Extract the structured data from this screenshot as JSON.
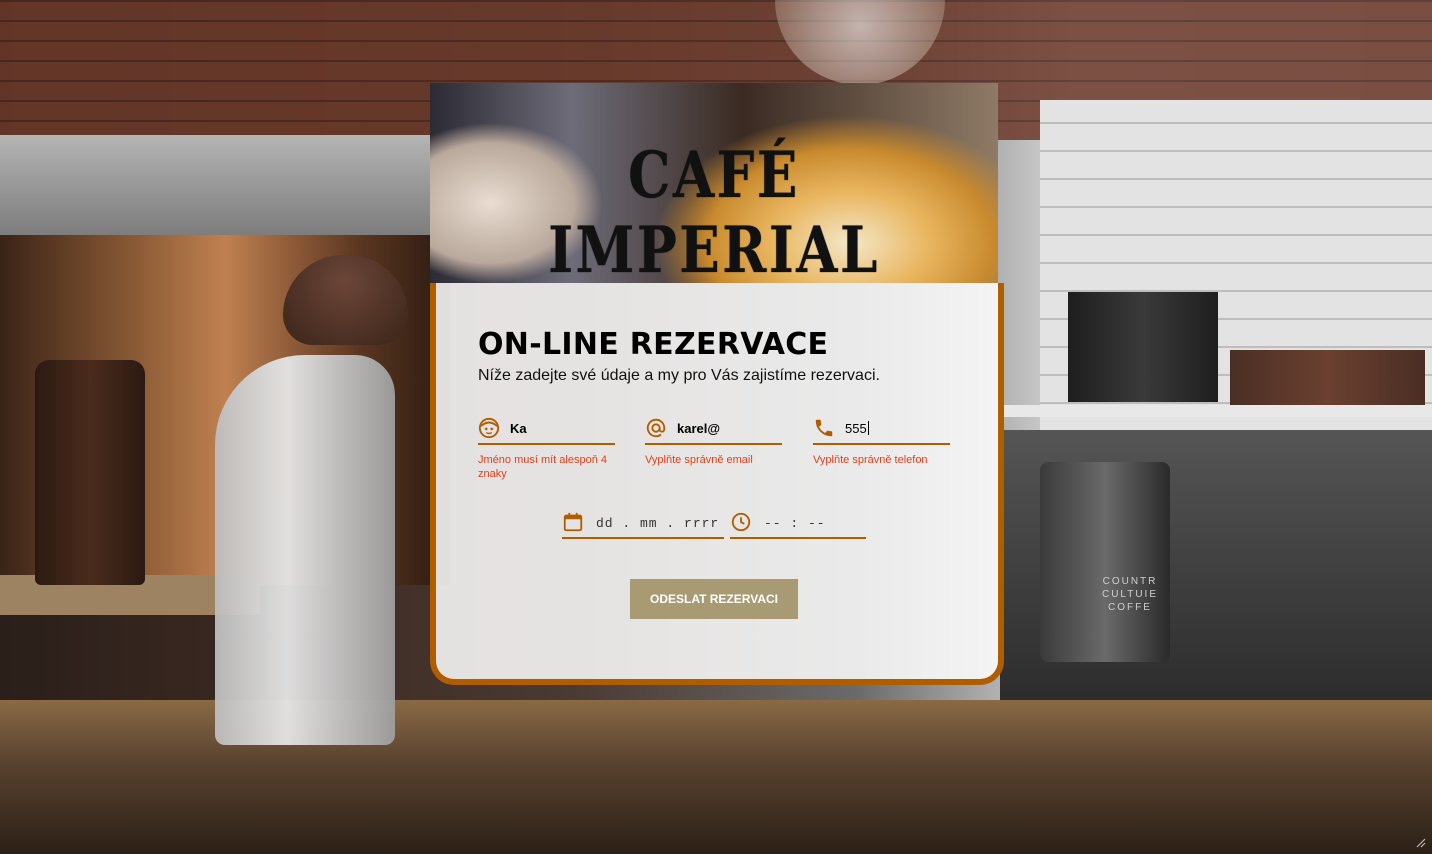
{
  "brand": {
    "name": "CAFÉ IMPERIAL"
  },
  "form": {
    "title": "ON-LINE REZERVACE",
    "subtitle": "Níže zadejte své údaje a my pro Vás zajistíme rezervaci.",
    "name_value": "Ka",
    "name_error": "Jméno musí mít alespoň 4 znaky",
    "email_value": "karel@",
    "email_error": "Vyplňte správně email",
    "phone_value": "555",
    "phone_error": "Vyplňte správně telefon",
    "date_placeholder": "dd . mm . rrrr",
    "time_placeholder": "-- : --",
    "submit_label": "ODESLAT REZERVACI"
  },
  "background": {
    "bag_label": "COUNTR CULTUIE COFFE"
  },
  "colors": {
    "accent": "#b05d00",
    "error": "#e0401a",
    "button": "#a89a73"
  }
}
